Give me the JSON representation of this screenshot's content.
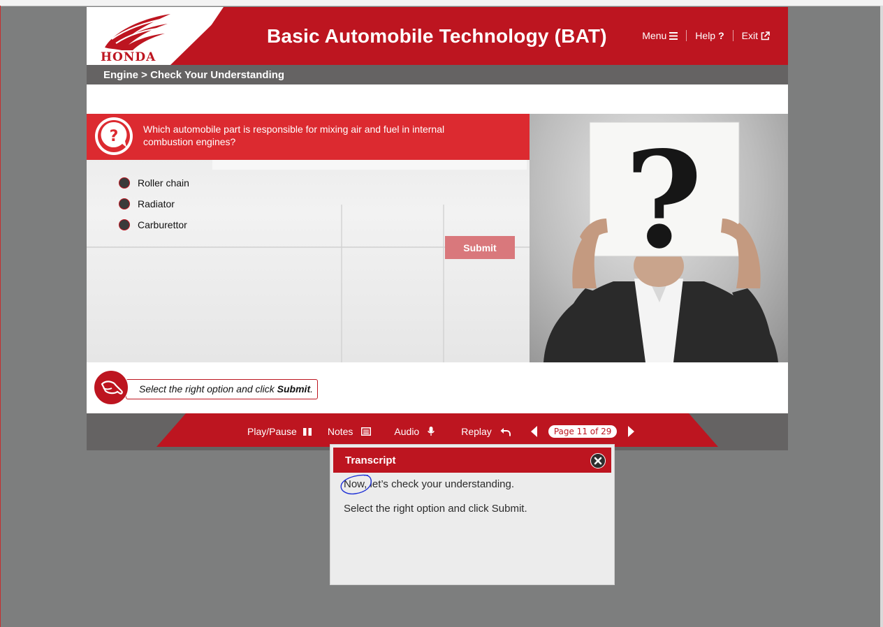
{
  "header": {
    "logo_text": "HONDA",
    "title": "Basic Automobile Technology (BAT)",
    "nav": {
      "menu_label": "Menu",
      "help_label": "Help",
      "exit_label": "Exit"
    }
  },
  "breadcrumb": "Engine > Check Your Understanding",
  "question": {
    "text": "Which automobile part is responsible for mixing air and fuel in internal combustion engines?",
    "options": [
      "Roller chain",
      "Radiator",
      "Carburettor"
    ],
    "submit_label": "Submit"
  },
  "photo": {
    "sign_glyph": "?"
  },
  "instruction": {
    "prefix": "Select the right option and click ",
    "emphasis": "Submit",
    "suffix": "."
  },
  "footer": {
    "play_pause_label": "Play/Pause",
    "notes_label": "Notes",
    "audio_label": "Audio",
    "replay_label": "Replay",
    "page_indicator": "Page 11 of 29"
  },
  "transcript": {
    "title": "Transcript",
    "lines": [
      "Now, let’s check your understanding.",
      "Select the right option and click Submit."
    ]
  },
  "colors": {
    "brand_red": "#bd1520",
    "question_red": "#dc2a30",
    "dark_gray": "#656363",
    "backdrop": "#7d7e7e",
    "submit_disabled": "#d9787c"
  },
  "icons": {
    "question": "question-bubble-icon",
    "instruction": "pointing-hand-icon",
    "menu": "hamburger-icon",
    "help": "question-mark-icon",
    "exit": "external-link-icon",
    "play_pause": "pause-icon",
    "notes": "notes-icon",
    "audio": "microphone-icon",
    "replay": "replay-icon",
    "prev": "prev-arrow-icon",
    "next": "next-arrow-icon",
    "close": "close-icon"
  }
}
